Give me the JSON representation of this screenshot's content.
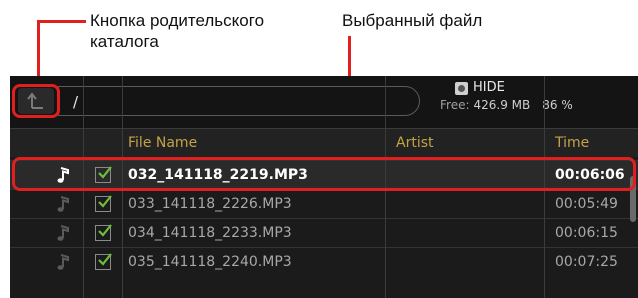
{
  "callouts": {
    "parent_button_line1": "Кнопка родительского",
    "parent_button_line2": "каталога",
    "selected_file": "Выбранный файл"
  },
  "path": "/",
  "media": {
    "name": "HIDE",
    "free_label": "Free:",
    "free_value": "426.9 MB",
    "used_percent": "86 %"
  },
  "columns": {
    "file_name": "File Name",
    "artist": "Artist",
    "time": "Time"
  },
  "rows": [
    {
      "file": "032_141118_2219.MP3",
      "artist": "",
      "time": "00:06:06",
      "selected": true,
      "checked": true
    },
    {
      "file": "033_141118_2226.MP3",
      "artist": "",
      "time": "00:05:49",
      "selected": false,
      "checked": true
    },
    {
      "file": "034_141118_2233.MP3",
      "artist": "",
      "time": "00:06:15",
      "selected": false,
      "checked": true
    },
    {
      "file": "035_141118_2240.MP3",
      "artist": "",
      "time": "00:07:25",
      "selected": false,
      "checked": true
    }
  ],
  "icons": {
    "parent": "up-arrow-icon",
    "media": "media-icon",
    "note": "music-note-icon",
    "check": "checkbox-checked-icon"
  },
  "colors": {
    "highlight": "#e02020",
    "header_text": "#c4a347",
    "check": "#6fbf3a"
  }
}
